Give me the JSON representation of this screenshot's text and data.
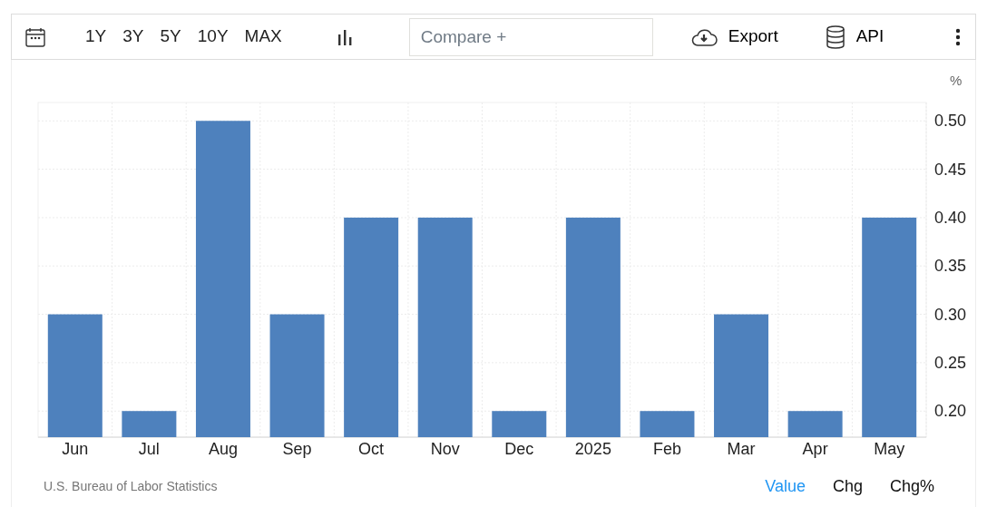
{
  "toolbar": {
    "ranges": [
      {
        "label": "1Y"
      },
      {
        "label": "3Y"
      },
      {
        "label": "5Y"
      },
      {
        "label": "10Y"
      },
      {
        "label": "MAX"
      }
    ],
    "compare": {
      "placeholder": "Compare +"
    },
    "export": "Export",
    "api": "API"
  },
  "chart": {
    "unit": "%",
    "chart_data": {
      "type": "bar",
      "categories": [
        "Jun",
        "Jul",
        "Aug",
        "Sep",
        "Oct",
        "Nov",
        "Dec",
        "2025",
        "Feb",
        "Mar",
        "Apr",
        "May"
      ],
      "grid": true,
      "series": [
        {
          "color": "#4e81bd",
          "values": [
            0.3,
            0.2,
            0.5,
            0.3,
            0.4,
            0.4,
            0.2,
            0.4,
            0.2,
            0.3,
            0.2,
            0.4
          ]
        }
      ],
      "ylim": [
        0.173,
        0.519
      ],
      "yticks": [
        {
          "value": 0.2,
          "label": "0.20"
        },
        {
          "value": 0.25,
          "label": "0.25"
        },
        {
          "value": 0.3,
          "label": "0.30"
        },
        {
          "value": 0.35,
          "label": "0.35"
        },
        {
          "value": 0.4,
          "label": "0.40"
        },
        {
          "value": 0.45,
          "label": "0.45"
        },
        {
          "value": 0.5,
          "label": "0.50"
        }
      ]
    }
  },
  "footer": {
    "source": "U.S. Bureau of Labor Statistics",
    "modes": [
      {
        "label": "Value",
        "selected": true
      },
      {
        "label": "Chg",
        "selected": false
      },
      {
        "label": "Chg%",
        "selected": false
      }
    ]
  }
}
